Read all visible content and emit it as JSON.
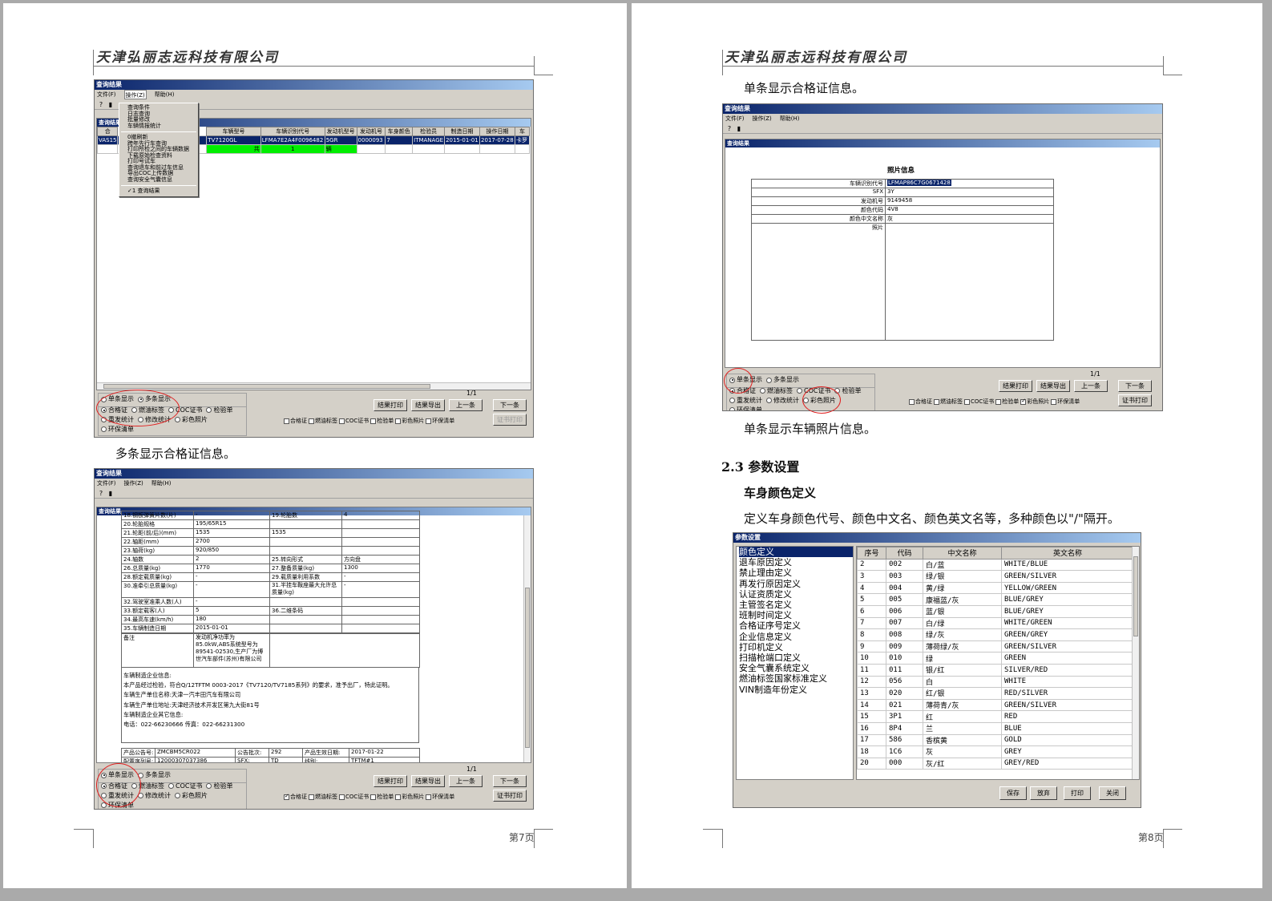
{
  "company": "天津弘丽志远科技有限公司",
  "page7": {
    "page_no": "第7页",
    "win1": {
      "title": "查询结果",
      "menus": [
        "文件(F)",
        "操作(Z)",
        "帮助(H)"
      ],
      "dropdown": [
        "查询条件",
        "日志查询",
        "批量修改",
        "车辆情报统计",
        "-",
        "0撤刷新",
        "跨年先行车查询",
        "打印所检之间的车辆数据",
        "下载原始检查资料",
        "打印号试车",
        "查询退车和前过车信息",
        "导出COC上传数据",
        "查询安全气囊信息",
        "-",
        "✓1 查询结果"
      ],
      "inner_title": "查询结果",
      "columns": [
        "合",
        "",
        "车辆型号",
        "车辆识别代号",
        "发动机型号",
        "发动机号",
        "车身颜色",
        "检验员",
        "制造日期",
        "操作日期",
        "车"
      ],
      "row": [
        "VAS15",
        "",
        "TV7120GL",
        "LFMA7E2A4F0096482",
        "5GR",
        "0000093",
        "7",
        "ITMANAGE",
        "2015-01-01",
        "2017-07-28",
        "卡罗"
      ],
      "summary": [
        "共",
        "1",
        "辆"
      ],
      "display_options": [
        "单条显示",
        "多条显示"
      ],
      "cert_options_row1": [
        "合格证",
        "燃油标签",
        "COC证书",
        "检验单"
      ],
      "cert_options_row2": [
        "重发统计",
        "修改统计",
        "彩色照片",
        "环保清单"
      ],
      "pager": "1/1",
      "buttons": [
        "结果打印",
        "结果导出",
        "上一条",
        "下一条"
      ],
      "checks": [
        "合格证",
        "燃油标签",
        "COC证书",
        "检验单",
        "彩色照片",
        "环保清单"
      ],
      "cert_print": "证书打印"
    },
    "caption1": "多条显示合格证信息。",
    "win2": {
      "title": "查询结果",
      "menus": [
        "文件(F)",
        "操作(Z)",
        "帮助(H)"
      ],
      "inner_title": "查询结果",
      "rows": [
        [
          "18.钢板弹簧片数(片)",
          "-",
          "19.轮胎数",
          "4"
        ],
        [
          "20.轮胎规格",
          "195/65R15",
          "",
          ""
        ],
        [
          "21.轮距(前/后)(mm)",
          "1535",
          "1535",
          ""
        ],
        [
          "22.轴距(mm)",
          "2700",
          "",
          ""
        ],
        [
          "23.轴荷(kg)",
          "920/850",
          "",
          ""
        ],
        [
          "24.轴数",
          "2",
          "25.转向形式",
          "方向盘"
        ],
        [
          "26.总质量(kg)",
          "1770",
          "27.整备质量(kg)",
          "1300"
        ],
        [
          "28.额定载质量(kg)",
          "-",
          "29.载质量利用系数",
          "-"
        ],
        [
          "30.准牵引总质量(kg)",
          "-",
          "31.半挂车鞍座最大允许总质量(kg)",
          "-"
        ],
        [
          "32.驾驶室准乘人数(人)",
          "-",
          "",
          ""
        ],
        [
          "33.额定载客(人)",
          "5",
          "36.二维条码",
          ""
        ],
        [
          "34.最高车速(km/h)",
          "180",
          "",
          ""
        ],
        [
          "35.车辆制造日期",
          "2015-01-01",
          "",
          ""
        ]
      ],
      "remark_label": "备注",
      "remark": "发动机净功率为85.0kW,ABS系统型号为89541-02530,生产厂为博世汽车部件(苏州)有限公司",
      "enterprise": [
        "车辆制造企业信息:",
        "本产品经过检验，符合Q/12TFTM 0003-2017《TV7120/TV7185系列》的要求，准予出厂，特此证明。",
        "车辆生产单位名称:天津一汽丰田汽车有限公司",
        "车辆生产单位地址:天津经济技术开发区第九大街81号",
        "车辆制造企业其它信息:",
        "电话：022-66230666 传真：022-66231300"
      ],
      "footer": [
        [
          "产品公告号:",
          "ZMCBM5CR022",
          "公告批次:",
          "292",
          "产品生效日期:",
          "2017-01-22"
        ],
        [
          "配置序列号:",
          "12000307037386",
          "SFX:",
          "TD",
          "线别:",
          "TFTM#1"
        ]
      ],
      "display_options": [
        "单条显示",
        "多条显示"
      ],
      "cert_options_row1": [
        "合格证",
        "燃油标签",
        "COC证书",
        "检验单"
      ],
      "cert_options_row2": [
        "重发统计",
        "修改统计",
        "彩色照片",
        "环保清单"
      ],
      "pager": "1/1",
      "buttons": [
        "结果打印",
        "结果导出",
        "上一条",
        "下一条"
      ],
      "checks": [
        "合格证",
        "燃油标签",
        "COC证书",
        "检验单",
        "彩色照片",
        "环保清单"
      ],
      "cert_print": "证书打印"
    }
  },
  "page8": {
    "page_no": "第8页",
    "caption1": "单条显示合格证信息。",
    "win3": {
      "title": "查询结果",
      "menus": [
        "文件(F)",
        "操作(Z)",
        "帮助(H)"
      ],
      "inner_title": "查询结果",
      "photo_title": "照片信息",
      "fields": [
        [
          "车辆识别代号",
          "LFMAP86C7G0671428"
        ],
        [
          "SFX",
          "3Y"
        ],
        [
          "发动机号",
          "9149458"
        ],
        [
          "颜色代码",
          "4V8"
        ],
        [
          "颜色中文名称",
          "灰"
        ],
        [
          "照片",
          ""
        ]
      ],
      "display_options": [
        "单条显示",
        "多条显示"
      ],
      "cert_options_row1": [
        "合格证",
        "燃油标签",
        "COC证书",
        "检验单"
      ],
      "cert_options_row2": [
        "重发统计",
        "修改统计",
        "彩色照片",
        "环保清单"
      ],
      "pager": "1/1",
      "buttons": [
        "结果打印",
        "结果导出",
        "上一条",
        "下一条"
      ],
      "checks": [
        "合格证",
        "燃油标签",
        "COC证书",
        "检验单",
        "彩色照片",
        "环保清单"
      ],
      "cert_print": "证书打印"
    },
    "caption2": "单条显示车辆照片信息。",
    "section": "2.3 参数设置",
    "subsection": "车身颜色定义",
    "body": "定义车身颜色代号、颜色中文名、颜色英文名等，多种颜色以\"/\"隔开。",
    "win4": {
      "title": "参数设置",
      "menu_items": [
        "颜色定义",
        "退车原因定义",
        "禁止理由定义",
        "再发行原因定义",
        "认证资质定义",
        "主管签名定义",
        "班制时间定义",
        "合格证序号定义",
        "企业信息定义",
        "打印机定义",
        "扫描枪端口定义",
        "安全气囊系统定义",
        "燃油标签国家标准定义",
        "VIN制造年份定义"
      ],
      "columns": [
        "序号",
        "代码",
        "中文名称",
        "英文名称"
      ],
      "rows": [
        [
          "2",
          "002",
          "白/蓝",
          "WHITE/BLUE"
        ],
        [
          "3",
          "003",
          "绿/银",
          "GREEN/SILVER"
        ],
        [
          "4",
          "004",
          "黄/绿",
          "YELLOW/GREEN"
        ],
        [
          "5",
          "005",
          "康福蓝/灰",
          "BLUE/GREY"
        ],
        [
          "6",
          "006",
          "蓝/银",
          "BLUE/GREY"
        ],
        [
          "7",
          "007",
          "白/绿",
          "WHITE/GREEN"
        ],
        [
          "8",
          "008",
          "绿/灰",
          "GREEN/GREY"
        ],
        [
          "9",
          "009",
          "薄荷绿/灰",
          "GREEN/SILVER"
        ],
        [
          "10",
          "010",
          "绿",
          "GREEN"
        ],
        [
          "11",
          "011",
          "银/红",
          "SILVER/RED"
        ],
        [
          "12",
          "056",
          "白",
          "WHITE"
        ],
        [
          "13",
          "020",
          "红/银",
          "RED/SILVER"
        ],
        [
          "14",
          "021",
          "薄荷青/灰",
          "GREEN/SILVER"
        ],
        [
          "15",
          "3P1",
          "红",
          "RED"
        ],
        [
          "16",
          "8P4",
          "兰",
          "BLUE"
        ],
        [
          "17",
          "586",
          "香槟黄",
          "GOLD"
        ],
        [
          "18",
          "1C6",
          "灰",
          "GREY"
        ],
        [
          "20",
          "000",
          "灰/红",
          "GREY/RED"
        ]
      ],
      "buttons": [
        "保存",
        "放弃",
        "打印",
        "关闭"
      ]
    }
  }
}
